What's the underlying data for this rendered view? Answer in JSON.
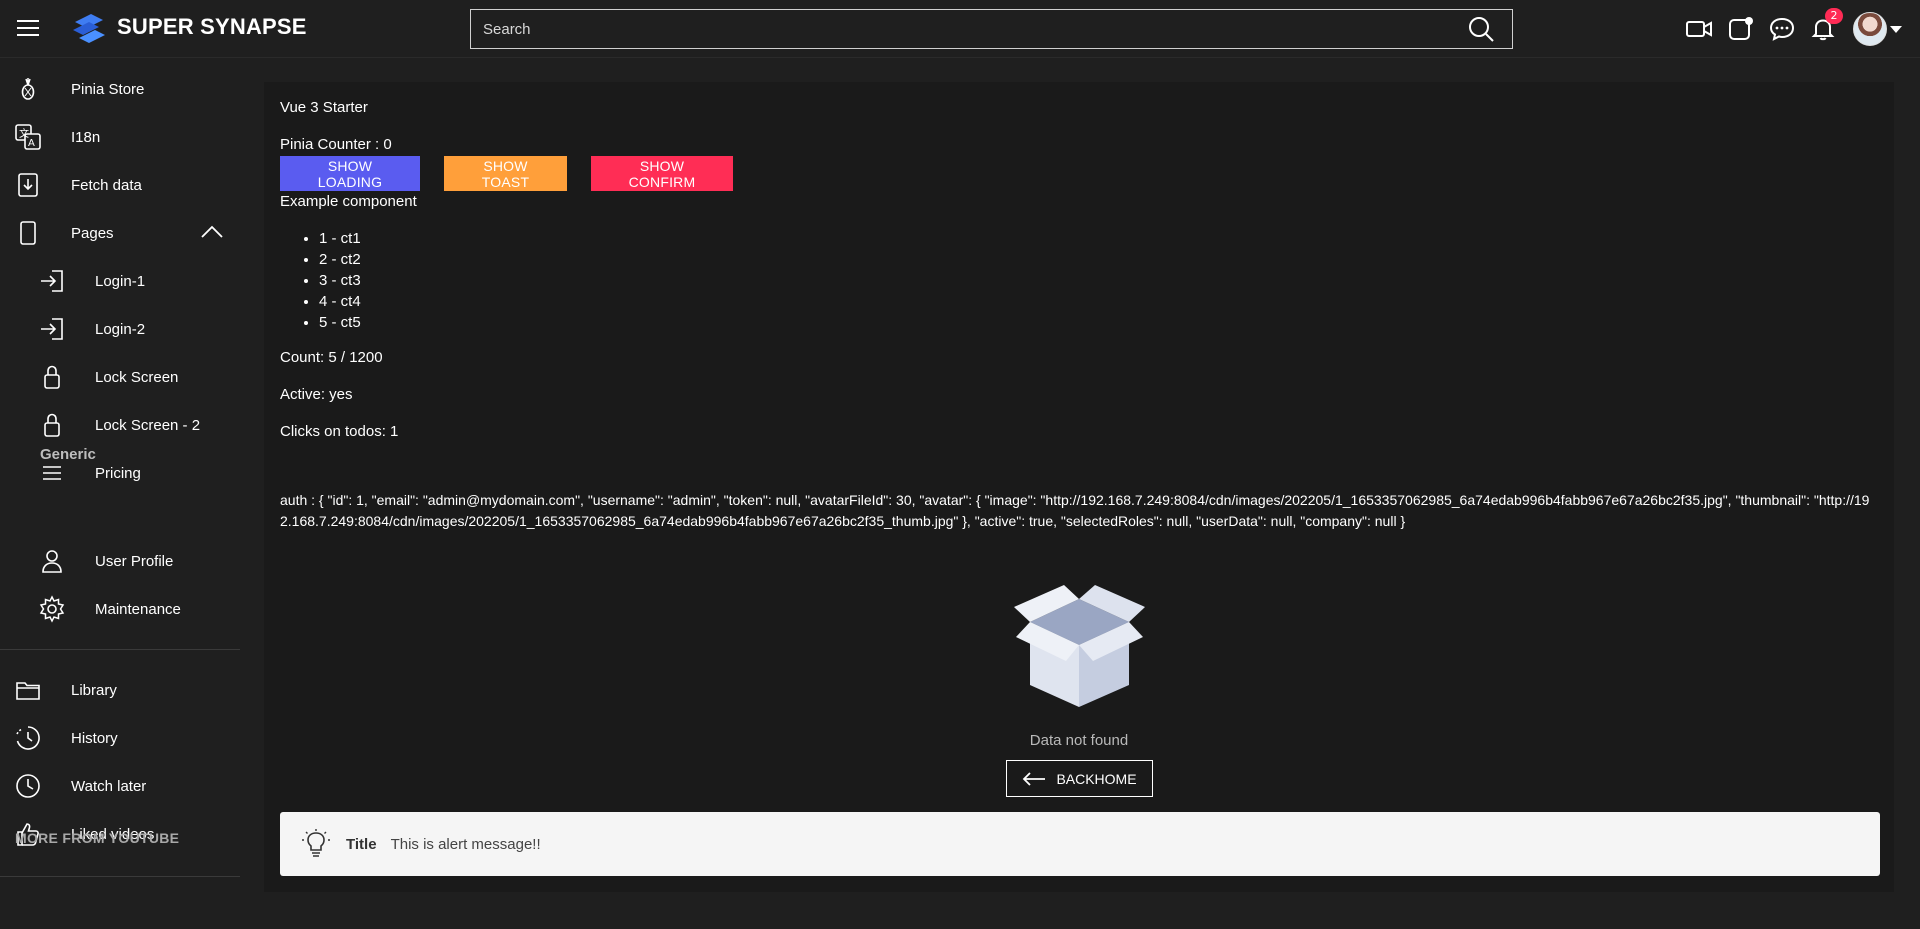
{
  "header": {
    "brand": "SUPER SYNAPSE",
    "search_placeholder": "Search",
    "notification_count": "2"
  },
  "sidebar": {
    "items": [
      {
        "label": "Pinia Store",
        "icon": "pineapple-icon"
      },
      {
        "label": "I18n",
        "icon": "translate-icon"
      },
      {
        "label": "Fetch data",
        "icon": "download-icon"
      },
      {
        "label": "Pages",
        "icon": "page-icon"
      },
      {
        "label": "Login-1",
        "icon": "login-icon"
      },
      {
        "label": "Login-2",
        "icon": "login-icon"
      },
      {
        "label": "Lock Screen",
        "icon": "lock-icon"
      },
      {
        "label": "Lock Screen - 2",
        "icon": "lock-icon"
      },
      {
        "label": "Pricing",
        "icon": "menu-lines-icon"
      },
      {
        "label": "User Profile",
        "icon": "user-icon"
      },
      {
        "label": "Maintenance",
        "icon": "gear-icon"
      },
      {
        "label": "Library",
        "icon": "folder-icon"
      },
      {
        "label": "History",
        "icon": "history-icon"
      },
      {
        "label": "Watch later",
        "icon": "clock-icon"
      },
      {
        "label": "Liked videos",
        "icon": "thumbs-up-icon"
      }
    ],
    "section_generic": "Generic",
    "more_from_youtube": "MORE FROM YOUTUBE"
  },
  "main": {
    "title": "Vue 3 Starter",
    "pinia_counter": "Pinia Counter : 0",
    "buttons": {
      "loading": "SHOW LOADING",
      "toast": "SHOW TOAST",
      "confirm": "SHOW CONFIRM"
    },
    "example_component": "Example component",
    "todos": [
      "1 - ct1",
      "2 - ct2",
      "3 - ct3",
      "4 - ct4",
      "5 - ct5"
    ],
    "count": "Count: 5 / 1200",
    "active": "Active: yes",
    "clicks": "Clicks on todos: 1",
    "auth": "auth : { \"id\": 1, \"email\": \"admin@mydomain.com\", \"username\": \"admin\", \"token\": null, \"avatarFileId\": 30, \"avatar\": { \"image\": \"http://192.168.7.249:8084/cdn/images/202205/1_1653357062985_6a74edab996b4fabb967e67a26bc2f35.jpg\", \"thumbnail\": \"http://192.168.7.249:8084/cdn/images/202205/1_1653357062985_6a74edab996b4fabb967e67a26bc2f35_thumb.jpg\" }, \"active\": true, \"selectedRoles\": null, \"userData\": null, \"company\": null }",
    "no_data": "Data not found",
    "backhome": "BACKHOME",
    "alert": {
      "title": "Title",
      "message": "This is alert message!!"
    }
  },
  "colors": {
    "loading_btn": "#5a5cf0",
    "toast_btn": "#ff9f3a",
    "confirm_btn": "#ff2d55",
    "badge": "#ff2b55"
  }
}
